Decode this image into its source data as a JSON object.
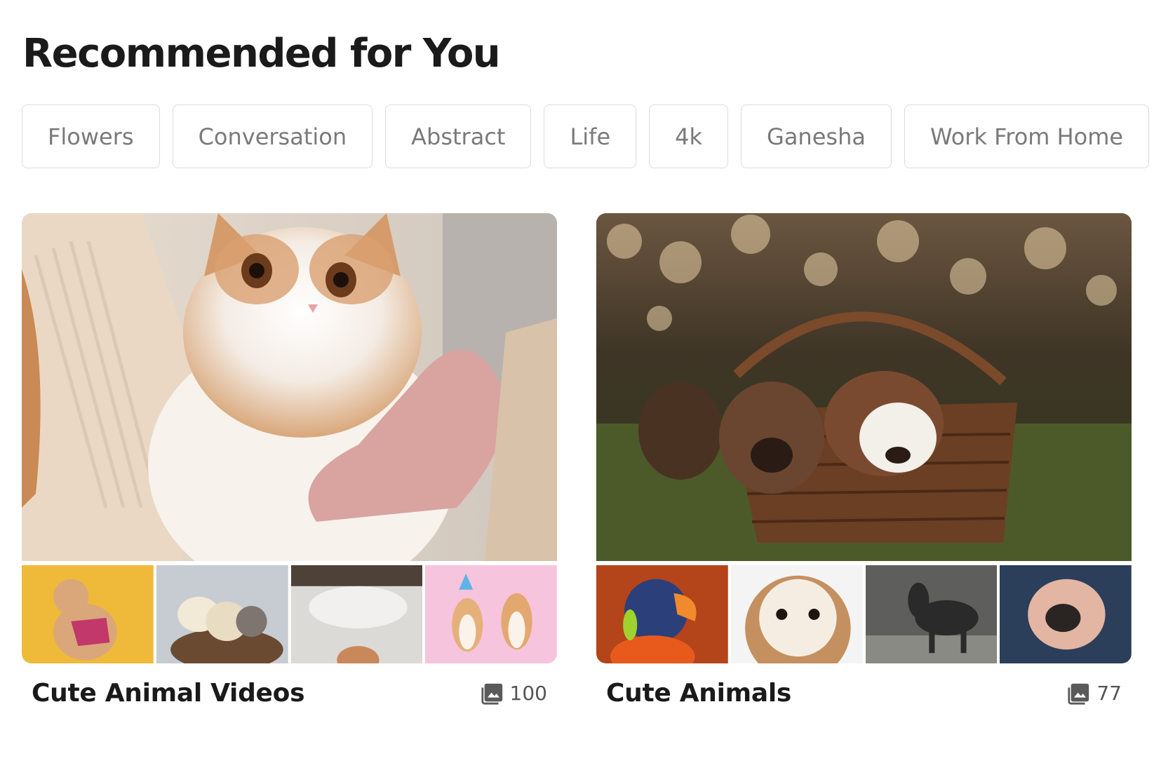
{
  "page_title": "Recommended for You",
  "chips": [
    "Flowers",
    "Conversation",
    "Abstract",
    "Life",
    "4k",
    "Ganesha",
    "Work From Home"
  ],
  "collections": [
    {
      "title": "Cute Animal Videos",
      "count": "100",
      "hero_subject": "cat",
      "thumbnails": [
        "poodle",
        "chicks",
        "pillow",
        "shiba-inus"
      ]
    },
    {
      "title": "Cute Animals",
      "count": "77",
      "hero_subject": "puppies-in-basket",
      "thumbnails": [
        "parrot",
        "owl",
        "pony",
        "hamster"
      ]
    }
  ],
  "icons": {
    "count_icon": "image-stack-icon"
  },
  "colors": {
    "chip_border": "#dcdcdc",
    "chip_text": "#7a7a7a",
    "heading": "#1a1a1a"
  }
}
